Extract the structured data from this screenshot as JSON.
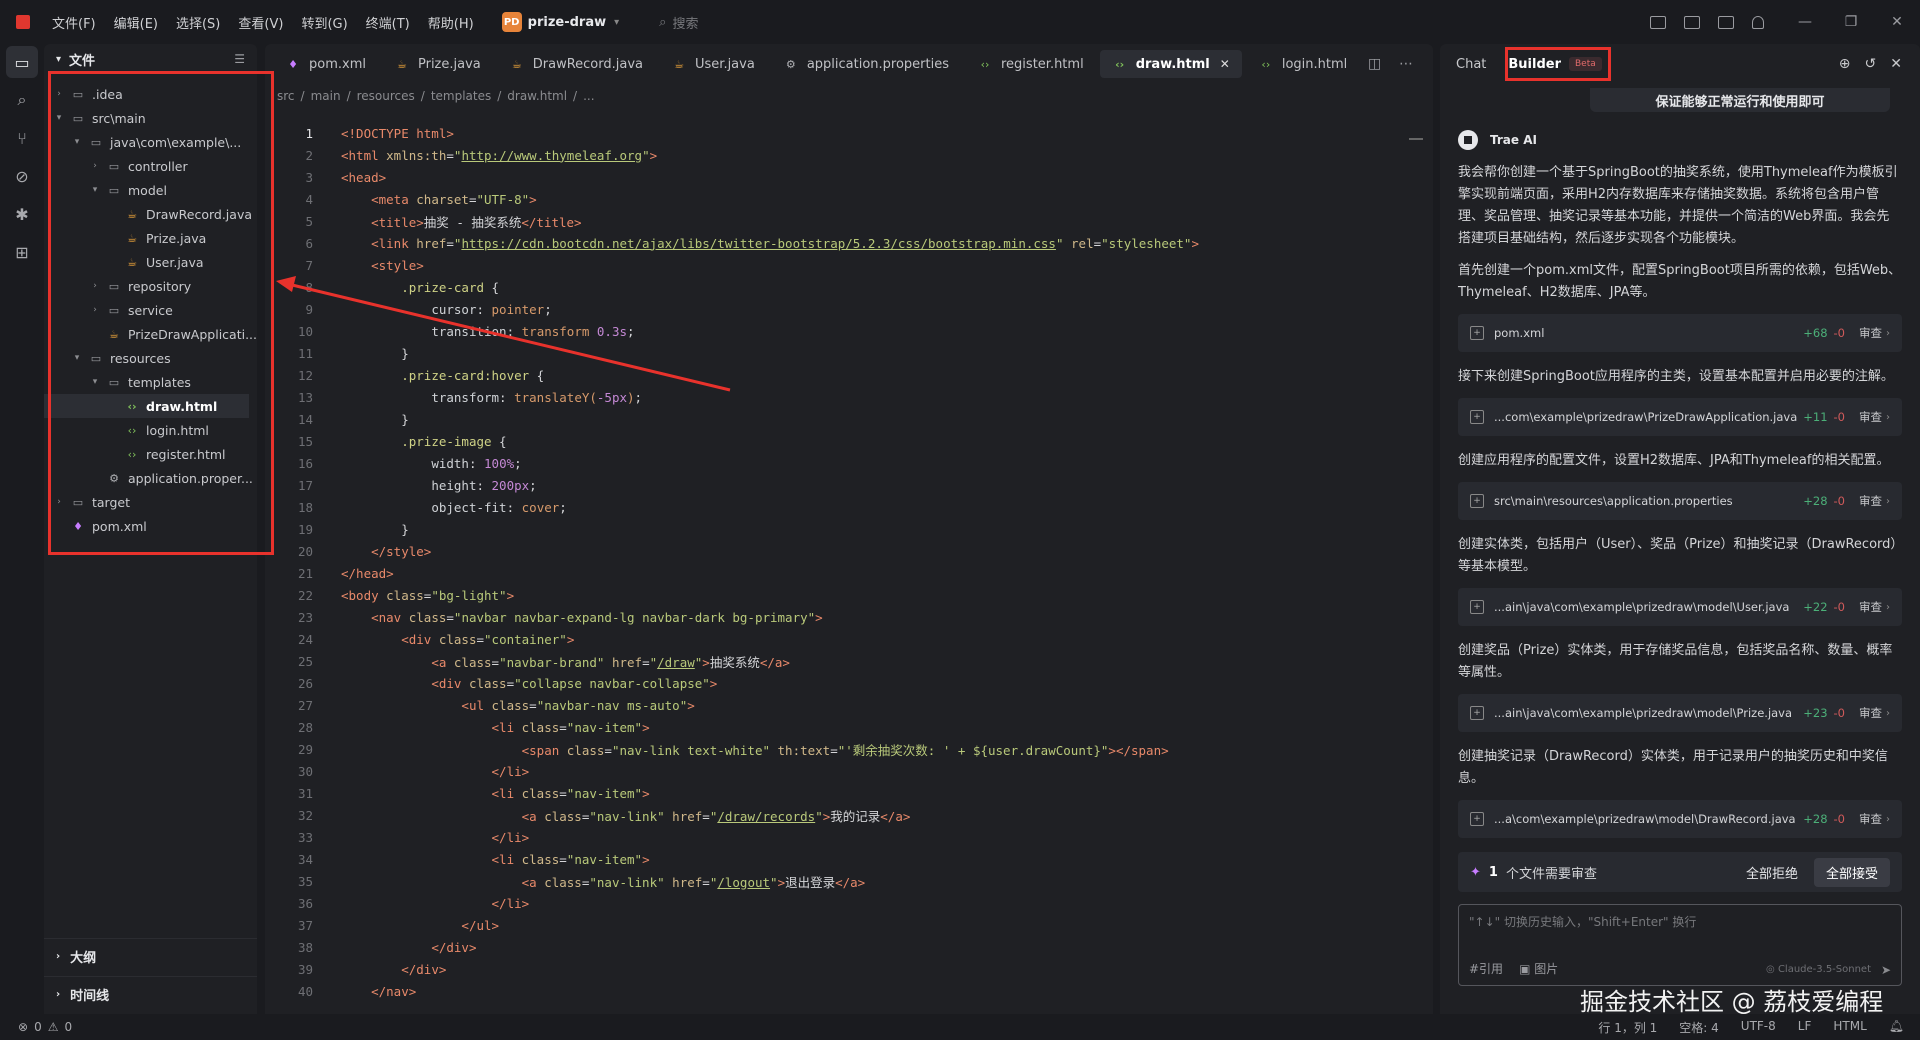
{
  "menu": [
    "文件(F)",
    "编辑(E)",
    "选择(S)",
    "查看(V)",
    "转到(G)",
    "终端(T)",
    "帮助(H)"
  ],
  "project": {
    "badge": "PD",
    "name": "prize-draw"
  },
  "search_placeholder": "搜索",
  "sidebar": {
    "title": "文件",
    "tree": [
      {
        "label": ".idea",
        "depth": 0,
        "type": "folder",
        "expanded": false
      },
      {
        "label": "src\\main",
        "depth": 0,
        "type": "folder",
        "expanded": true
      },
      {
        "label": "java\\com\\example\\...",
        "depth": 1,
        "type": "folder",
        "expanded": true
      },
      {
        "label": "controller",
        "depth": 2,
        "type": "folder",
        "expanded": false
      },
      {
        "label": "model",
        "depth": 2,
        "type": "folder",
        "expanded": true
      },
      {
        "label": "DrawRecord.java",
        "depth": 3,
        "type": "java"
      },
      {
        "label": "Prize.java",
        "depth": 3,
        "type": "java"
      },
      {
        "label": "User.java",
        "depth": 3,
        "type": "java"
      },
      {
        "label": "repository",
        "depth": 2,
        "type": "folder",
        "expanded": false
      },
      {
        "label": "service",
        "depth": 2,
        "type": "folder",
        "expanded": false
      },
      {
        "label": "PrizeDrawApplicati...",
        "depth": 2,
        "type": "java"
      },
      {
        "label": "resources",
        "depth": 1,
        "type": "folder",
        "expanded": true
      },
      {
        "label": "templates",
        "depth": 2,
        "type": "folder",
        "expanded": true
      },
      {
        "label": "draw.html",
        "depth": 3,
        "type": "html",
        "selected": true
      },
      {
        "label": "login.html",
        "depth": 3,
        "type": "html"
      },
      {
        "label": "register.html",
        "depth": 3,
        "type": "html"
      },
      {
        "label": "application.proper...",
        "depth": 2,
        "type": "gear"
      },
      {
        "label": "target",
        "depth": 0,
        "type": "folder",
        "expanded": false
      },
      {
        "label": "pom.xml",
        "depth": 0,
        "type": "pom"
      }
    ],
    "outline": "大纲",
    "timeline": "时间线"
  },
  "editor": {
    "tabs": [
      {
        "label": "pom.xml",
        "icon": "pom"
      },
      {
        "label": "Prize.java",
        "icon": "java"
      },
      {
        "label": "DrawRecord.java",
        "icon": "java"
      },
      {
        "label": "User.java",
        "icon": "java"
      },
      {
        "label": "application.properties",
        "icon": "gear"
      },
      {
        "label": "register.html",
        "icon": "html"
      },
      {
        "label": "draw.html",
        "icon": "html",
        "active": true
      },
      {
        "label": "login.html",
        "icon": "html"
      }
    ],
    "breadcrumb": [
      "src",
      "main",
      "resources",
      "templates",
      "draw.html",
      "..."
    ],
    "lines": [
      [
        [
          "tag",
          "<!DOCTYPE html>"
        ]
      ],
      [
        [
          "tag",
          "<html "
        ],
        [
          "attr",
          "xmlns:th"
        ],
        [
          "txt",
          "="
        ],
        [
          "str",
          "\""
        ],
        [
          "url",
          "http://www.thymeleaf.org"
        ],
        [
          "str",
          "\""
        ],
        [
          "tag",
          ">"
        ]
      ],
      [
        [
          "tag",
          "<head>"
        ]
      ],
      [
        [
          "txt",
          "    "
        ],
        [
          "tag",
          "<meta "
        ],
        [
          "attr",
          "charset"
        ],
        [
          "txt",
          "="
        ],
        [
          "str",
          "\"UTF-8\""
        ],
        [
          "tag",
          ">"
        ]
      ],
      [
        [
          "txt",
          "    "
        ],
        [
          "tag",
          "<title>"
        ],
        [
          "txt",
          "抽奖 - 抽奖系统"
        ],
        [
          "tag",
          "</title>"
        ]
      ],
      [
        [
          "txt",
          "    "
        ],
        [
          "tag",
          "<link "
        ],
        [
          "attr",
          "href"
        ],
        [
          "txt",
          "="
        ],
        [
          "str",
          "\""
        ],
        [
          "url",
          "https://cdn.bootcdn.net/ajax/libs/twitter-bootstrap/5.2.3/css/bootstrap.min.css"
        ],
        [
          "str",
          "\""
        ],
        [
          "txt",
          " "
        ],
        [
          "attr",
          "rel"
        ],
        [
          "txt",
          "="
        ],
        [
          "str",
          "\"stylesheet\""
        ],
        [
          "tag",
          ">"
        ]
      ],
      [
        [
          "txt",
          "    "
        ],
        [
          "tag",
          "<style>"
        ]
      ],
      [
        [
          "txt",
          "        "
        ],
        [
          "sel-cls",
          ".prize-card"
        ],
        [
          "txt",
          " {"
        ]
      ],
      [
        [
          "txt",
          "            "
        ],
        [
          "prop",
          "cursor"
        ],
        [
          "txt",
          ": "
        ],
        [
          "val",
          "pointer"
        ],
        [
          "txt",
          ";"
        ]
      ],
      [
        [
          "txt",
          "            "
        ],
        [
          "prop",
          "transition"
        ],
        [
          "txt",
          ": "
        ],
        [
          "val",
          "transform "
        ],
        [
          "num",
          "0.3s"
        ],
        [
          "txt",
          ";"
        ]
      ],
      [
        [
          "txt",
          "        }"
        ]
      ],
      [
        [
          "txt",
          "        "
        ],
        [
          "sel-cls",
          ".prize-card:hover"
        ],
        [
          "txt",
          " {"
        ]
      ],
      [
        [
          "txt",
          "            "
        ],
        [
          "prop",
          "transform"
        ],
        [
          "txt",
          ": "
        ],
        [
          "val",
          "translateY("
        ],
        [
          "num",
          "-5px"
        ],
        [
          "val",
          ")"
        ],
        [
          "txt",
          ";"
        ]
      ],
      [
        [
          "txt",
          "        }"
        ]
      ],
      [
        [
          "txt",
          "        "
        ],
        [
          "sel-cls",
          ".prize-image"
        ],
        [
          "txt",
          " {"
        ]
      ],
      [
        [
          "txt",
          "            "
        ],
        [
          "prop",
          "width"
        ],
        [
          "txt",
          ": "
        ],
        [
          "num",
          "100%"
        ],
        [
          "txt",
          ";"
        ]
      ],
      [
        [
          "txt",
          "            "
        ],
        [
          "prop",
          "height"
        ],
        [
          "txt",
          ": "
        ],
        [
          "num",
          "200px"
        ],
        [
          "txt",
          ";"
        ]
      ],
      [
        [
          "txt",
          "            "
        ],
        [
          "prop",
          "object-fit"
        ],
        [
          "txt",
          ": "
        ],
        [
          "val",
          "cover"
        ],
        [
          "txt",
          ";"
        ]
      ],
      [
        [
          "txt",
          "        }"
        ]
      ],
      [
        [
          "txt",
          "    "
        ],
        [
          "tag",
          "</style>"
        ]
      ],
      [
        [
          "tag",
          "</head>"
        ]
      ],
      [
        [
          "tag",
          "<body "
        ],
        [
          "attr",
          "class"
        ],
        [
          "txt",
          "="
        ],
        [
          "str",
          "\"bg-light\""
        ],
        [
          "tag",
          ">"
        ]
      ],
      [
        [
          "txt",
          "    "
        ],
        [
          "tag",
          "<nav "
        ],
        [
          "attr",
          "class"
        ],
        [
          "txt",
          "="
        ],
        [
          "str",
          "\"navbar navbar-expand-lg navbar-dark bg-primary\""
        ],
        [
          "tag",
          ">"
        ]
      ],
      [
        [
          "txt",
          "        "
        ],
        [
          "tag",
          "<div "
        ],
        [
          "attr",
          "class"
        ],
        [
          "txt",
          "="
        ],
        [
          "str",
          "\"container\""
        ],
        [
          "tag",
          ">"
        ]
      ],
      [
        [
          "txt",
          "            "
        ],
        [
          "tag",
          "<a "
        ],
        [
          "attr",
          "class"
        ],
        [
          "txt",
          "="
        ],
        [
          "str",
          "\"navbar-brand\""
        ],
        [
          "txt",
          " "
        ],
        [
          "attr",
          "href"
        ],
        [
          "txt",
          "="
        ],
        [
          "str",
          "\""
        ],
        [
          "url",
          "/draw"
        ],
        [
          "str",
          "\""
        ],
        [
          "tag",
          ">"
        ],
        [
          "txt",
          "抽奖系统"
        ],
        [
          "tag",
          "</a>"
        ]
      ],
      [
        [
          "txt",
          "            "
        ],
        [
          "tag",
          "<div "
        ],
        [
          "attr",
          "class"
        ],
        [
          "txt",
          "="
        ],
        [
          "str",
          "\"collapse navbar-collapse\""
        ],
        [
          "tag",
          ">"
        ]
      ],
      [
        [
          "txt",
          "                "
        ],
        [
          "tag",
          "<ul "
        ],
        [
          "attr",
          "class"
        ],
        [
          "txt",
          "="
        ],
        [
          "str",
          "\"navbar-nav ms-auto\""
        ],
        [
          "tag",
          ">"
        ]
      ],
      [
        [
          "txt",
          "                    "
        ],
        [
          "tag",
          "<li "
        ],
        [
          "attr",
          "class"
        ],
        [
          "txt",
          "="
        ],
        [
          "str",
          "\"nav-item\""
        ],
        [
          "tag",
          ">"
        ]
      ],
      [
        [
          "txt",
          "                        "
        ],
        [
          "tag",
          "<span "
        ],
        [
          "attr",
          "class"
        ],
        [
          "txt",
          "="
        ],
        [
          "str",
          "\"nav-link text-white\""
        ],
        [
          "txt",
          " "
        ],
        [
          "attr",
          "th:text"
        ],
        [
          "txt",
          "="
        ],
        [
          "str",
          "\"'剩余抽奖次数: ' + ${user.drawCount}\""
        ],
        [
          "tag",
          "></span>"
        ]
      ],
      [
        [
          "txt",
          "                    "
        ],
        [
          "tag",
          "</li>"
        ]
      ],
      [
        [
          "txt",
          "                    "
        ],
        [
          "tag",
          "<li "
        ],
        [
          "attr",
          "class"
        ],
        [
          "txt",
          "="
        ],
        [
          "str",
          "\"nav-item\""
        ],
        [
          "tag",
          ">"
        ]
      ],
      [
        [
          "txt",
          "                        "
        ],
        [
          "tag",
          "<a "
        ],
        [
          "attr",
          "class"
        ],
        [
          "txt",
          "="
        ],
        [
          "str",
          "\"nav-link\""
        ],
        [
          "txt",
          " "
        ],
        [
          "attr",
          "href"
        ],
        [
          "txt",
          "="
        ],
        [
          "str",
          "\""
        ],
        [
          "url",
          "/draw/records"
        ],
        [
          "str",
          "\""
        ],
        [
          "tag",
          ">"
        ],
        [
          "txt",
          "我的记录"
        ],
        [
          "tag",
          "</a>"
        ]
      ],
      [
        [
          "txt",
          "                    "
        ],
        [
          "tag",
          "</li>"
        ]
      ],
      [
        [
          "txt",
          "                    "
        ],
        [
          "tag",
          "<li "
        ],
        [
          "attr",
          "class"
        ],
        [
          "txt",
          "="
        ],
        [
          "str",
          "\"nav-item\""
        ],
        [
          "tag",
          ">"
        ]
      ],
      [
        [
          "txt",
          "                        "
        ],
        [
          "tag",
          "<a "
        ],
        [
          "attr",
          "class"
        ],
        [
          "txt",
          "="
        ],
        [
          "str",
          "\"nav-link\""
        ],
        [
          "txt",
          " "
        ],
        [
          "attr",
          "href"
        ],
        [
          "txt",
          "="
        ],
        [
          "str",
          "\""
        ],
        [
          "url",
          "/logout"
        ],
        [
          "str",
          "\""
        ],
        [
          "tag",
          ">"
        ],
        [
          "txt",
          "退出登录"
        ],
        [
          "tag",
          "</a>"
        ]
      ],
      [
        [
          "txt",
          "                    "
        ],
        [
          "tag",
          "</li>"
        ]
      ],
      [
        [
          "txt",
          "                "
        ],
        [
          "tag",
          "</ul>"
        ]
      ],
      [
        [
          "txt",
          "            "
        ],
        [
          "tag",
          "</div>"
        ]
      ],
      [
        [
          "txt",
          "        "
        ],
        [
          "tag",
          "</div>"
        ]
      ],
      [
        [
          "txt",
          "    "
        ],
        [
          "tag",
          "</nav>"
        ]
      ]
    ]
  },
  "panel": {
    "tab_chat": "Chat",
    "tab_builder": "Builder",
    "beta": "Beta",
    "banner": "保证能够正常运行和使用即可",
    "ai_name": "Trae AI",
    "intro": "我会帮你创建一个基于SpringBoot的抽奖系统，使用Thymeleaf作为模板引擎实现前端页面，采用H2内存数据库来存储抽奖数据。系统将包含用户管理、奖品管理、抽奖记录等基本功能，并提供一个简洁的Web界面。我会先搭建项目基础结构，然后逐步实现各个功能模块。",
    "steps": [
      {
        "text": "首先创建一个pom.xml文件，配置SpringBoot项目所需的依赖，包括Web、Thymeleaf、H2数据库、JPA等。",
        "file": "pom.xml",
        "add": "+68",
        "del": "-0"
      },
      {
        "text": "接下来创建SpringBoot应用程序的主类，设置基本配置并启用必要的注解。",
        "file": "...com\\example\\prizedraw\\PrizeDrawApplication.java",
        "add": "+11",
        "del": "-0"
      },
      {
        "text": "创建应用程序的配置文件，设置H2数据库、JPA和Thymeleaf的相关配置。",
        "file": "src\\main\\resources\\application.properties",
        "add": "+28",
        "del": "-0"
      },
      {
        "text": "创建实体类，包括用户（User）、奖品（Prize）和抽奖记录（DrawRecord）等基本模型。",
        "file": "...ain\\java\\com\\example\\prizedraw\\model\\User.java",
        "add": "+22",
        "del": "-0"
      },
      {
        "text": "创建奖品（Prize）实体类，用于存储奖品信息，包括奖品名称、数量、概率等属性。",
        "file": "...ain\\java\\com\\example\\prizedraw\\model\\Prize.java",
        "add": "+23",
        "del": "-0"
      },
      {
        "text": "创建抽奖记录（DrawRecord）实体类，用于记录用户的抽奖历史和中奖信息。",
        "file": "...a\\com\\example\\prizedraw\\model\\DrawRecord.java",
        "add": "+28",
        "del": "-0"
      }
    ],
    "review_label": "审查",
    "summary_count": "1",
    "summary_label": "个文件需要审查",
    "reject_all": "全部拒绝",
    "accept_all": "全部接受",
    "input_placeholder": "\"↑↓\" 切换历史输入，\"Shift+Enter\" 换行",
    "tool_ref": "#引用",
    "tool_img": "图片",
    "model": "Claude-3.5-Sonnet"
  },
  "watermark": "掘金技术社区 @ 荔枝爱编程",
  "status": {
    "errors": "0",
    "warnings": "0",
    "position": "行 1，列 1",
    "spaces": "空格: 4",
    "encoding": "UTF-8",
    "eol": "LF",
    "language": "HTML"
  }
}
